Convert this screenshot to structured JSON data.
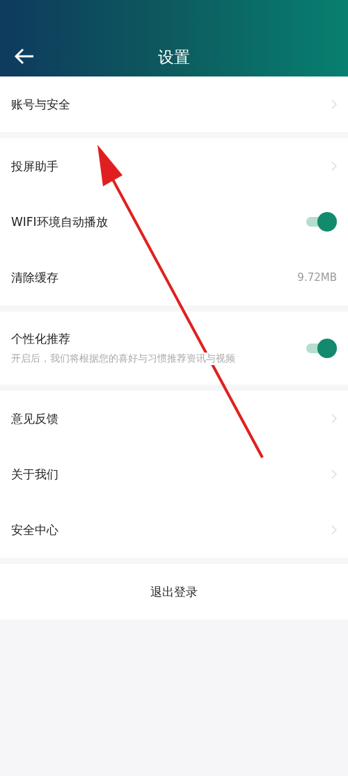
{
  "header": {
    "title": "设置"
  },
  "groups": [
    {
      "rows": [
        {
          "kind": "link",
          "label": "账号与安全"
        }
      ]
    },
    {
      "rows": [
        {
          "kind": "link",
          "label": "投屏助手"
        },
        {
          "kind": "toggle",
          "label": "WIFI环境自动播放",
          "on": true
        },
        {
          "kind": "value",
          "label": "清除缓存",
          "value": "9.72MB"
        }
      ]
    },
    {
      "rows": [
        {
          "kind": "toggle",
          "label": "个性化推荐",
          "subtitle": "开启后，我们将根据您的喜好与习惯推荐资讯与视频",
          "on": true
        }
      ]
    },
    {
      "rows": [
        {
          "kind": "link",
          "label": "意见反馈"
        },
        {
          "kind": "link",
          "label": "关于我们"
        },
        {
          "kind": "link",
          "label": "安全中心"
        }
      ]
    }
  ],
  "logout": {
    "label": "退出登录"
  }
}
